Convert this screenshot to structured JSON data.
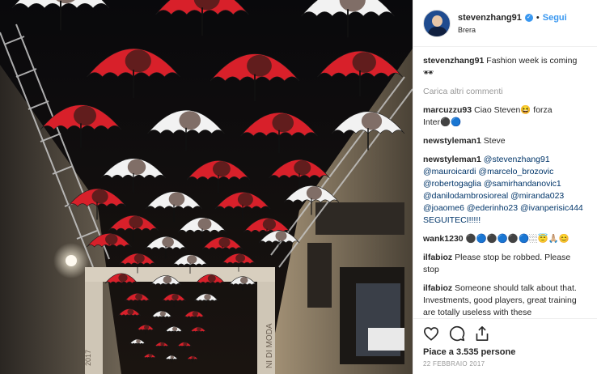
{
  "header": {
    "username": "stevenzhang91",
    "verified_mark": "✓",
    "separator": "•",
    "follow_label": "Segui",
    "location": "Brera"
  },
  "caption": {
    "user": "stevenzhang91",
    "text": "Fashion week is coming 🕶"
  },
  "load_more_label": "Carica altri commenti",
  "comments": [
    {
      "user": "marcuzzu93",
      "text": "Ciao Steven😆 forza Inter⚫🔵"
    },
    {
      "user": "newstyleman1",
      "text": "Steve"
    },
    {
      "user": "newstyleman1",
      "text": "@stevenzhang91 @mauroicardi @marcelo_brozovic @robertogaglia @samirhandanovic1 @danilodambrosioreal @miranda023 @joaome6 @ederinho23 @ivanperisic444 SEGUITECI!!!!!"
    },
    {
      "user": "wank1230",
      "text": "⚫🔵⚫🔵⚫🔵🏼😇🙏🏼😊"
    },
    {
      "user": "ilfabioz",
      "text": "Please stop be robbed. Please stop"
    },
    {
      "user": "ilfabioz",
      "text": "Someone should talk about that. Investments, good players, great training are totally useless with these"
    }
  ],
  "actions": {
    "like_icon": "heart-icon",
    "comment_icon": "comment-icon",
    "share_icon": "share-icon"
  },
  "likes_text": "Piace a 3.535 persone",
  "date_text": "22 FEBBRAIO 2017",
  "photo": {
    "sign_text": "NI DI MODA",
    "year_text": "2017"
  },
  "colors": {
    "accent": "#3897f0",
    "umbrella_red": "#d8202a",
    "umbrella_white": "#f2f2f2"
  }
}
